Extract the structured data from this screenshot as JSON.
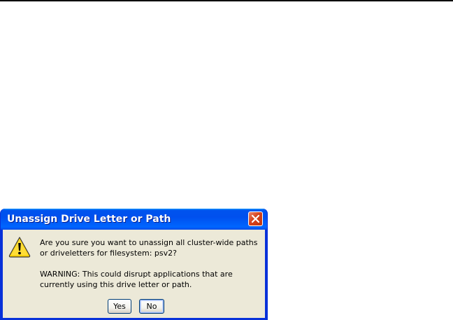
{
  "dialog": {
    "title": "Unassign Drive Letter or Path",
    "message_line_1": "Are you sure you want to unassign all cluster-wide paths",
    "message_line_2": "or driveletters for filesystem: psv2?",
    "warning_line_1": "WARNING: This could disrupt applications that are",
    "warning_line_2": "currently using this drive letter or path.",
    "icon": "warning-icon",
    "buttons": {
      "yes_label": "Yes",
      "no_label": "No"
    }
  },
  "colors": {
    "title_bar": "#0053ee",
    "close_button": "#d6421b",
    "dialog_background": "#ece9d8",
    "warning_yellow": "#ffd200"
  }
}
